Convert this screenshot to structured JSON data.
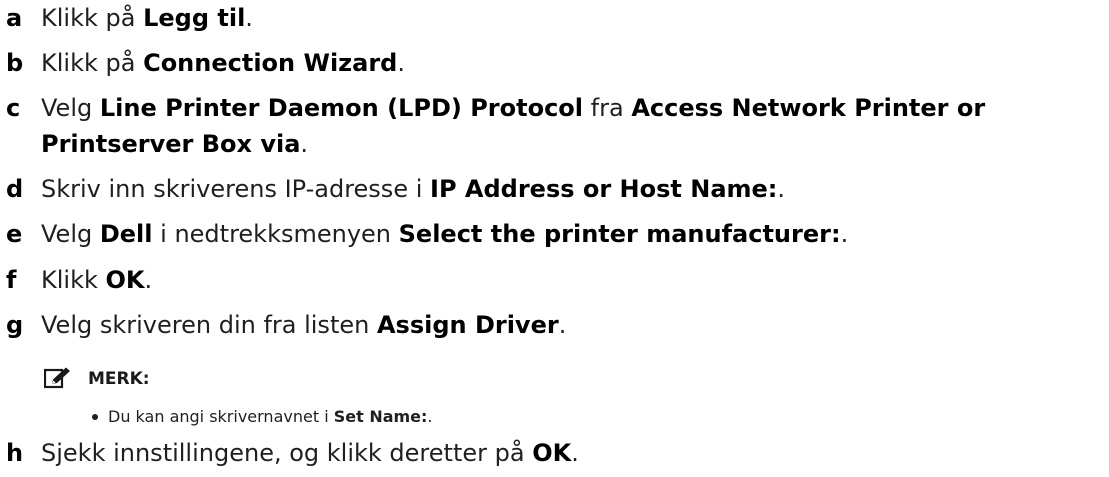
{
  "steps": [
    {
      "letter": "a",
      "lines": [
        [
          {
            "t": "Klikk på "
          },
          {
            "t": "Legg til",
            "b": true
          },
          {
            "t": "."
          }
        ]
      ]
    },
    {
      "letter": "b",
      "lines": [
        [
          {
            "t": "Klikk på "
          },
          {
            "t": "Connection Wizard",
            "b": true
          },
          {
            "t": "."
          }
        ]
      ]
    },
    {
      "letter": "c",
      "lines": [
        [
          {
            "t": "Velg "
          },
          {
            "t": "Line Printer Daemon (LPD) Protocol",
            "b": true
          },
          {
            "t": " fra "
          },
          {
            "t": "Access Network Printer or",
            "b": true
          }
        ],
        [
          {
            "t": "Printserver Box via",
            "b": true
          },
          {
            "t": "."
          }
        ]
      ]
    },
    {
      "letter": "d",
      "lines": [
        [
          {
            "t": "Skriv inn skriverens IP-adresse i "
          },
          {
            "t": "IP Address or Host Name:",
            "b": true
          },
          {
            "t": "."
          }
        ]
      ]
    },
    {
      "letter": "e",
      "lines": [
        [
          {
            "t": "Velg "
          },
          {
            "t": "Dell",
            "b": true
          },
          {
            "t": " i nedtrekksmenyen "
          },
          {
            "t": "Select the printer manufacturer:",
            "b": true
          },
          {
            "t": "."
          }
        ]
      ]
    },
    {
      "letter": "f",
      "lines": [
        [
          {
            "t": "Klikk "
          },
          {
            "t": "OK",
            "b": true
          },
          {
            "t": "."
          }
        ]
      ]
    },
    {
      "letter": "g",
      "lines": [
        [
          {
            "t": "Velg skriveren din fra listen "
          },
          {
            "t": "Assign Driver",
            "b": true
          },
          {
            "t": "."
          }
        ]
      ]
    },
    {
      "letter": "h",
      "lines": [
        [
          {
            "t": "Sjekk innstillingene, og klikk deretter på "
          },
          {
            "t": "OK",
            "b": true
          },
          {
            "t": "."
          }
        ]
      ]
    }
  ],
  "note": {
    "icon": "pencil-note-icon",
    "title": "MERK:",
    "bullet": [
      {
        "t": "Du kan angi skrivernavnet i "
      },
      {
        "t": "Set Name:",
        "b": true
      },
      {
        "t": "."
      }
    ]
  }
}
